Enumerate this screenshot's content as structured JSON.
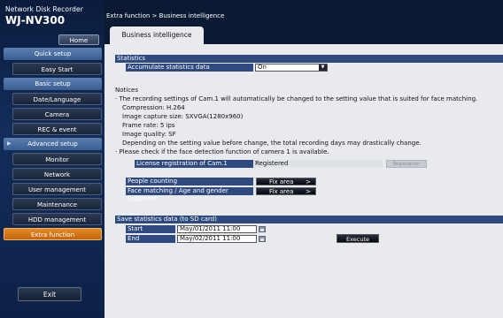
{
  "device": {
    "line1": "Network Disk Recorder",
    "line2": "WJ-NV300"
  },
  "home_label": "Home",
  "nav": [
    {
      "label": "Quick setup",
      "type": "cat"
    },
    {
      "label": "Easy Start",
      "type": "sub"
    },
    {
      "label": "Basic setup",
      "type": "cat"
    },
    {
      "label": "Date/Language",
      "type": "sub"
    },
    {
      "label": "Camera",
      "type": "sub"
    },
    {
      "label": "REC & event",
      "type": "sub"
    },
    {
      "label": "Advanced setup",
      "type": "cat",
      "arrow": "▶"
    },
    {
      "label": "Monitor",
      "type": "sub"
    },
    {
      "label": "Network",
      "type": "sub"
    },
    {
      "label": "User management",
      "type": "sub"
    },
    {
      "label": "Maintenance",
      "type": "sub"
    },
    {
      "label": "HDD management",
      "type": "sub"
    },
    {
      "label": "Extra function",
      "type": "active"
    }
  ],
  "exit_label": "Exit",
  "breadcrumb": "Extra function > Business intelligence",
  "tab": "Business intelligence",
  "statistics": {
    "header": "Statistics",
    "accumulate_label": "Accumulate statistics data",
    "accumulate_value": "On",
    "notices_title": "Notices",
    "notice1": "· The recording settings of Cam.1 will automatically be changed to the setting value that is suited for face matching.",
    "compression": "Compression: H.264",
    "capture_size": "Image capture size: SXVGA(1280x960)",
    "frame_rate": "Frame rate: 5 ips",
    "image_quality": "Image quality: SF",
    "depending": "Depending on the setting value before change, the total recording days may drastically change.",
    "notice2": "· Please check if the face detection function of camera 1 is available.",
    "license_label": "License registration of Cam.1",
    "license_value": "Registered",
    "registration_btn": "Registration",
    "people_counting_label": "People counting",
    "face_matching_label": "Face matching / Age and gender judgment",
    "fix_area_label": "Fix area",
    "chevron": ">"
  },
  "save": {
    "header": "Save statistics data (to SD card)",
    "start_label": "Start",
    "start_value": "May/01/2011 11:00",
    "end_label": "End",
    "end_value": "May/02/2011 11:00",
    "execute_label": "Execute"
  },
  "colors": {
    "section_header": "#2e4a7e",
    "active_nav": "#e48a22",
    "panel_bg": "#e8eaee"
  }
}
